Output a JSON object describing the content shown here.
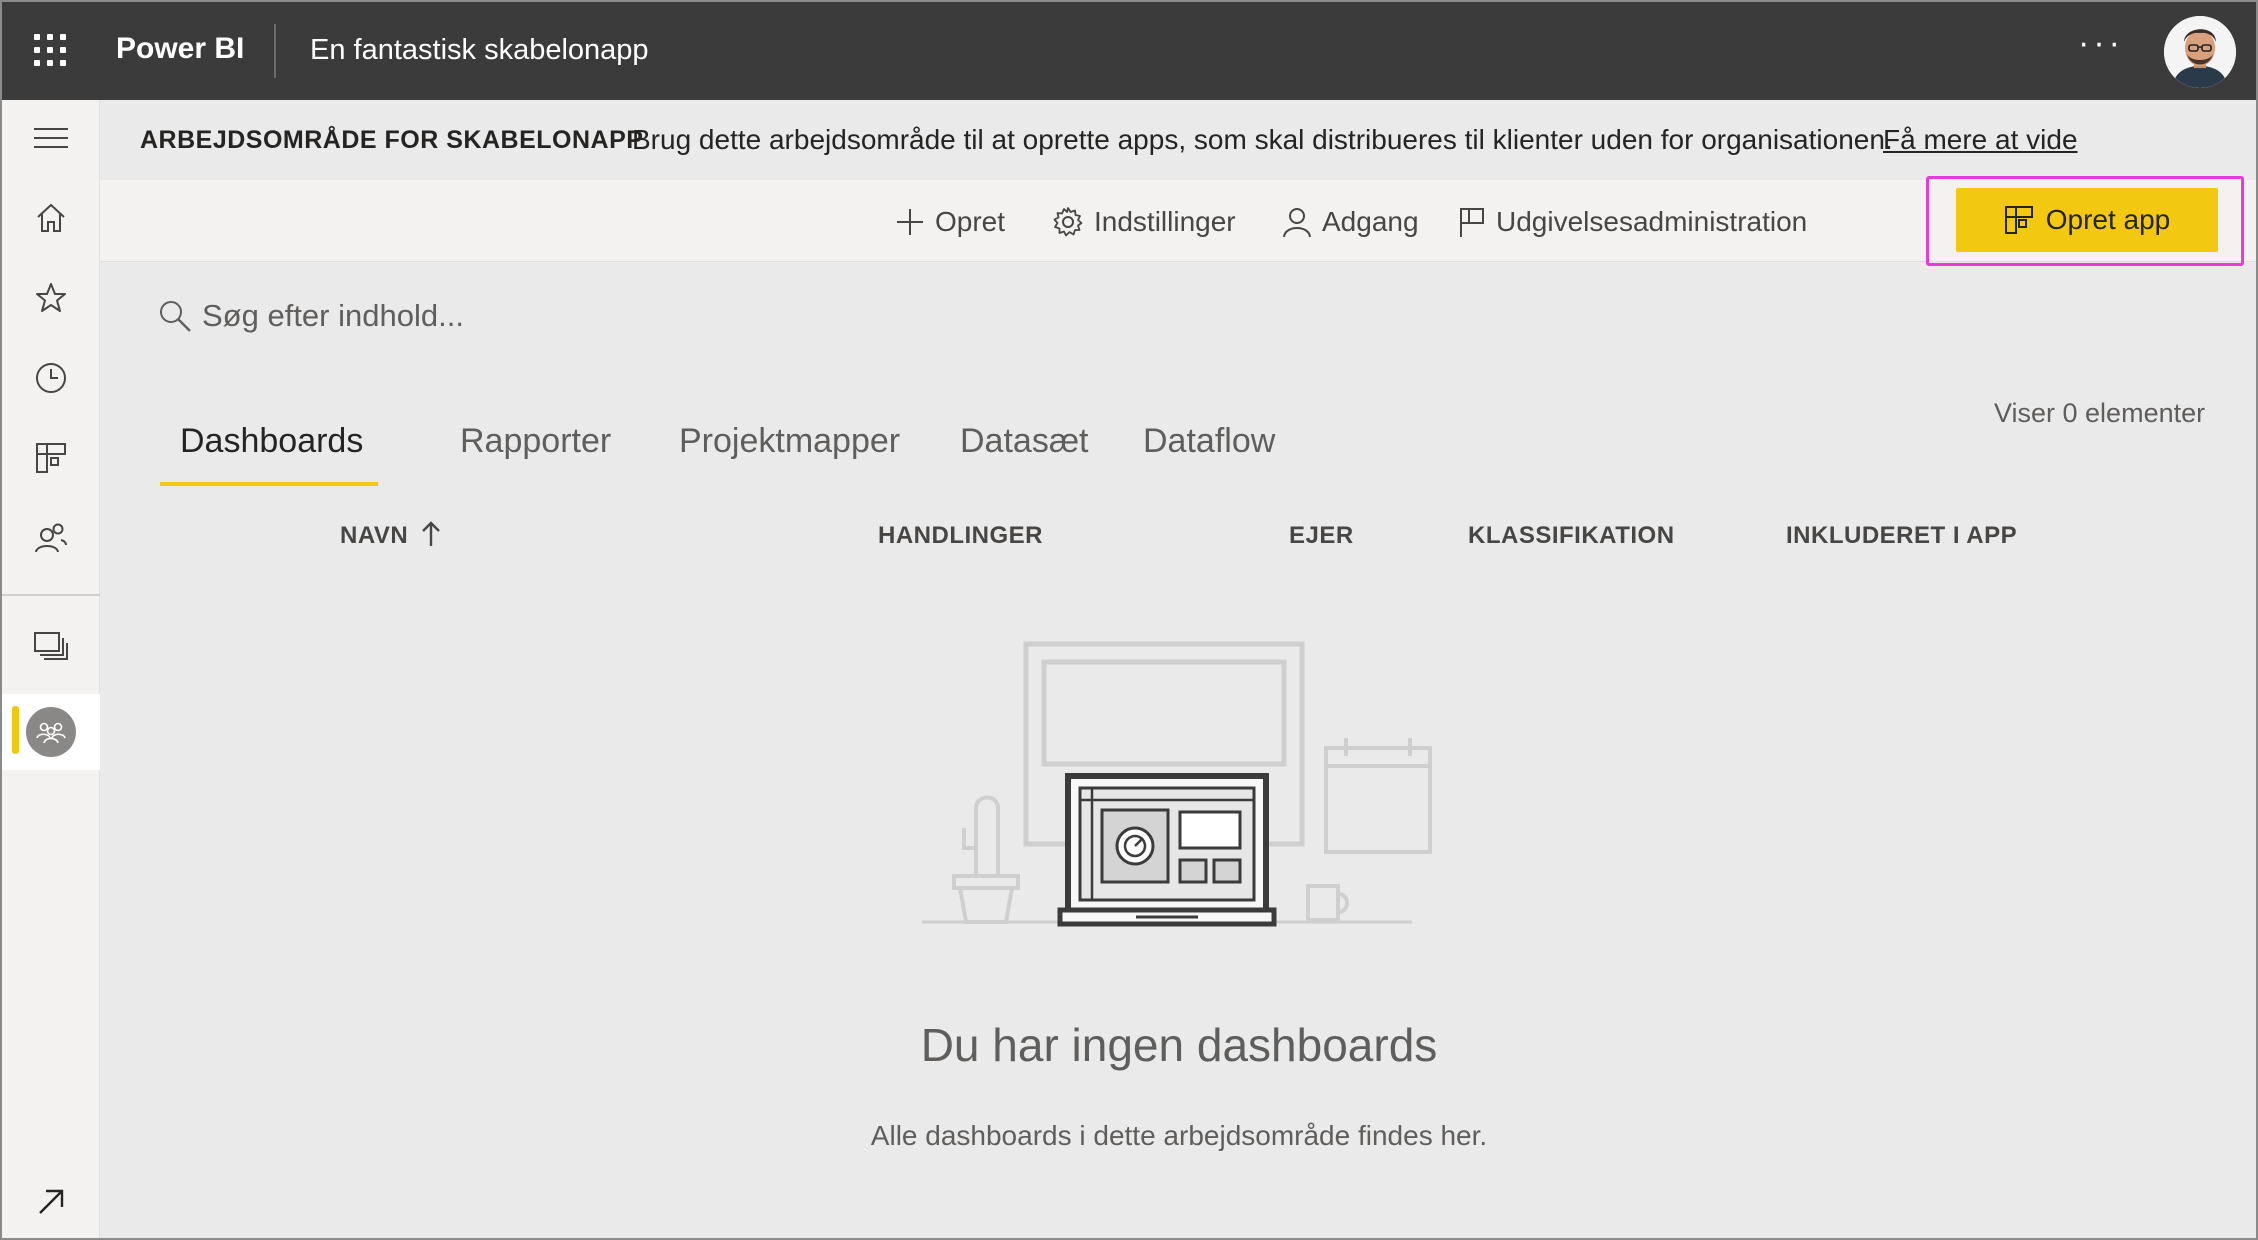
{
  "header": {
    "brand": "Power BI",
    "workspace_name": "En fantastisk skabelonapp",
    "more_label": "···"
  },
  "banner": {
    "title": "ARBEJDSOMRÅDE FOR SKABELONAPP",
    "text": "Brug dette arbejdsområde til at oprette apps, som skal distribueres til klienter uden for organisationen.",
    "link": "Få mere at vide"
  },
  "commands": {
    "create": "Opret",
    "settings": "Indstillinger",
    "access": "Adgang",
    "release": "Udgivelsesadministration",
    "create_app": "Opret app",
    "more": "···"
  },
  "search": {
    "placeholder": "Søg efter indhold..."
  },
  "tabs": [
    {
      "label": "Dashboards",
      "active": true
    },
    {
      "label": "Rapporter"
    },
    {
      "label": "Projektmapper"
    },
    {
      "label": "Datasæt"
    },
    {
      "label": "Dataflow"
    }
  ],
  "item_count": "Viser 0 elementer",
  "columns": {
    "name": "NAVN",
    "actions": "HANDLINGER",
    "owner": "EJER",
    "classification": "KLASSIFIKATION",
    "included": "INKLUDERET I APP"
  },
  "empty_state": {
    "title": "Du har ingen dashboards",
    "subtitle": "Alle dashboards i dette arbejdsområde findes her."
  },
  "nav_icons": [
    "menu-icon",
    "home-icon",
    "star-icon",
    "clock-icon",
    "apps-icon",
    "shared-icon",
    "workspaces-icon",
    "workspace-icon",
    "expand-icon"
  ],
  "colors": {
    "accent": "#f2c811",
    "highlight": "#e83ad6",
    "topbar": "#3b3b3b"
  }
}
